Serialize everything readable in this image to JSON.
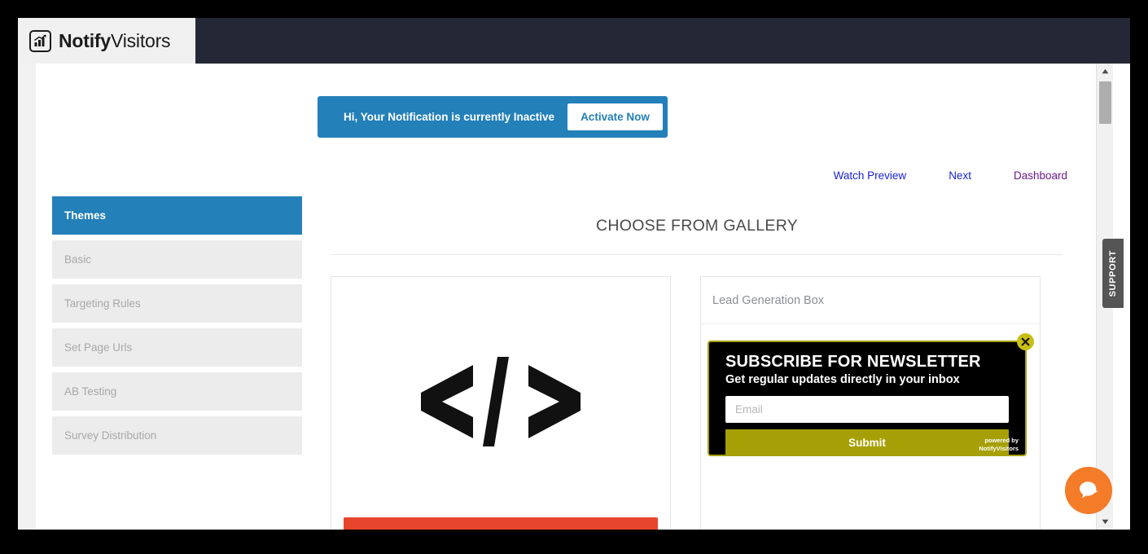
{
  "header": {
    "logo_icon": "bar-chart-growth-icon",
    "logo_bold": "Notify",
    "logo_thin": "Visitors"
  },
  "banner": {
    "message": "Hi, Your Notification is currently Inactive",
    "button_label": "Activate Now",
    "background_color": "#2380b9"
  },
  "topnav": {
    "links": [
      {
        "label": "Watch Preview",
        "state": "unvisited"
      },
      {
        "label": "Next",
        "state": "unvisited"
      },
      {
        "label": "Dashboard",
        "state": "visited"
      }
    ],
    "link_color": "#1a23d6",
    "visited_color": "#6b1a8f"
  },
  "sidebar": {
    "items": [
      {
        "label": "Themes",
        "active": true
      },
      {
        "label": "Basic",
        "active": false
      },
      {
        "label": "Targeting Rules",
        "active": false
      },
      {
        "label": "Set Page Urls",
        "active": false
      },
      {
        "label": "AB Testing",
        "active": false
      },
      {
        "label": "Survey Distribution",
        "active": false
      }
    ],
    "active_color": "#2380b9",
    "inactive_color": "#ececec"
  },
  "gallery": {
    "title": "CHOOSE FROM GALLERY",
    "cards": [
      {
        "name": "custom-html-card",
        "icon": "code-brackets-icon",
        "bar_color": "#e8452f"
      },
      {
        "name": "lead-generation-card",
        "title": "Lead Generation Box",
        "popup": {
          "heading": "SUBSCRIBE FOR NEWSLETTER",
          "subheading": "Get regular updates directly in your inbox",
          "email_placeholder": "Email",
          "email_value": "",
          "submit_label": "Submit",
          "powered_by_line1": "powered by",
          "powered_by_line2": "NotifyVisitors",
          "close_icon": "close-x-icon",
          "background_color": "#000000",
          "accent_color": "#a6a006"
        }
      }
    ]
  },
  "support_tab": {
    "label": "SUPPORT"
  },
  "chat_widget": {
    "icon": "chat-bubble-icon",
    "color": "#f47b28"
  },
  "scrollbar": {
    "up_icon": "caret-up-icon",
    "down_icon": "caret-down-icon"
  }
}
